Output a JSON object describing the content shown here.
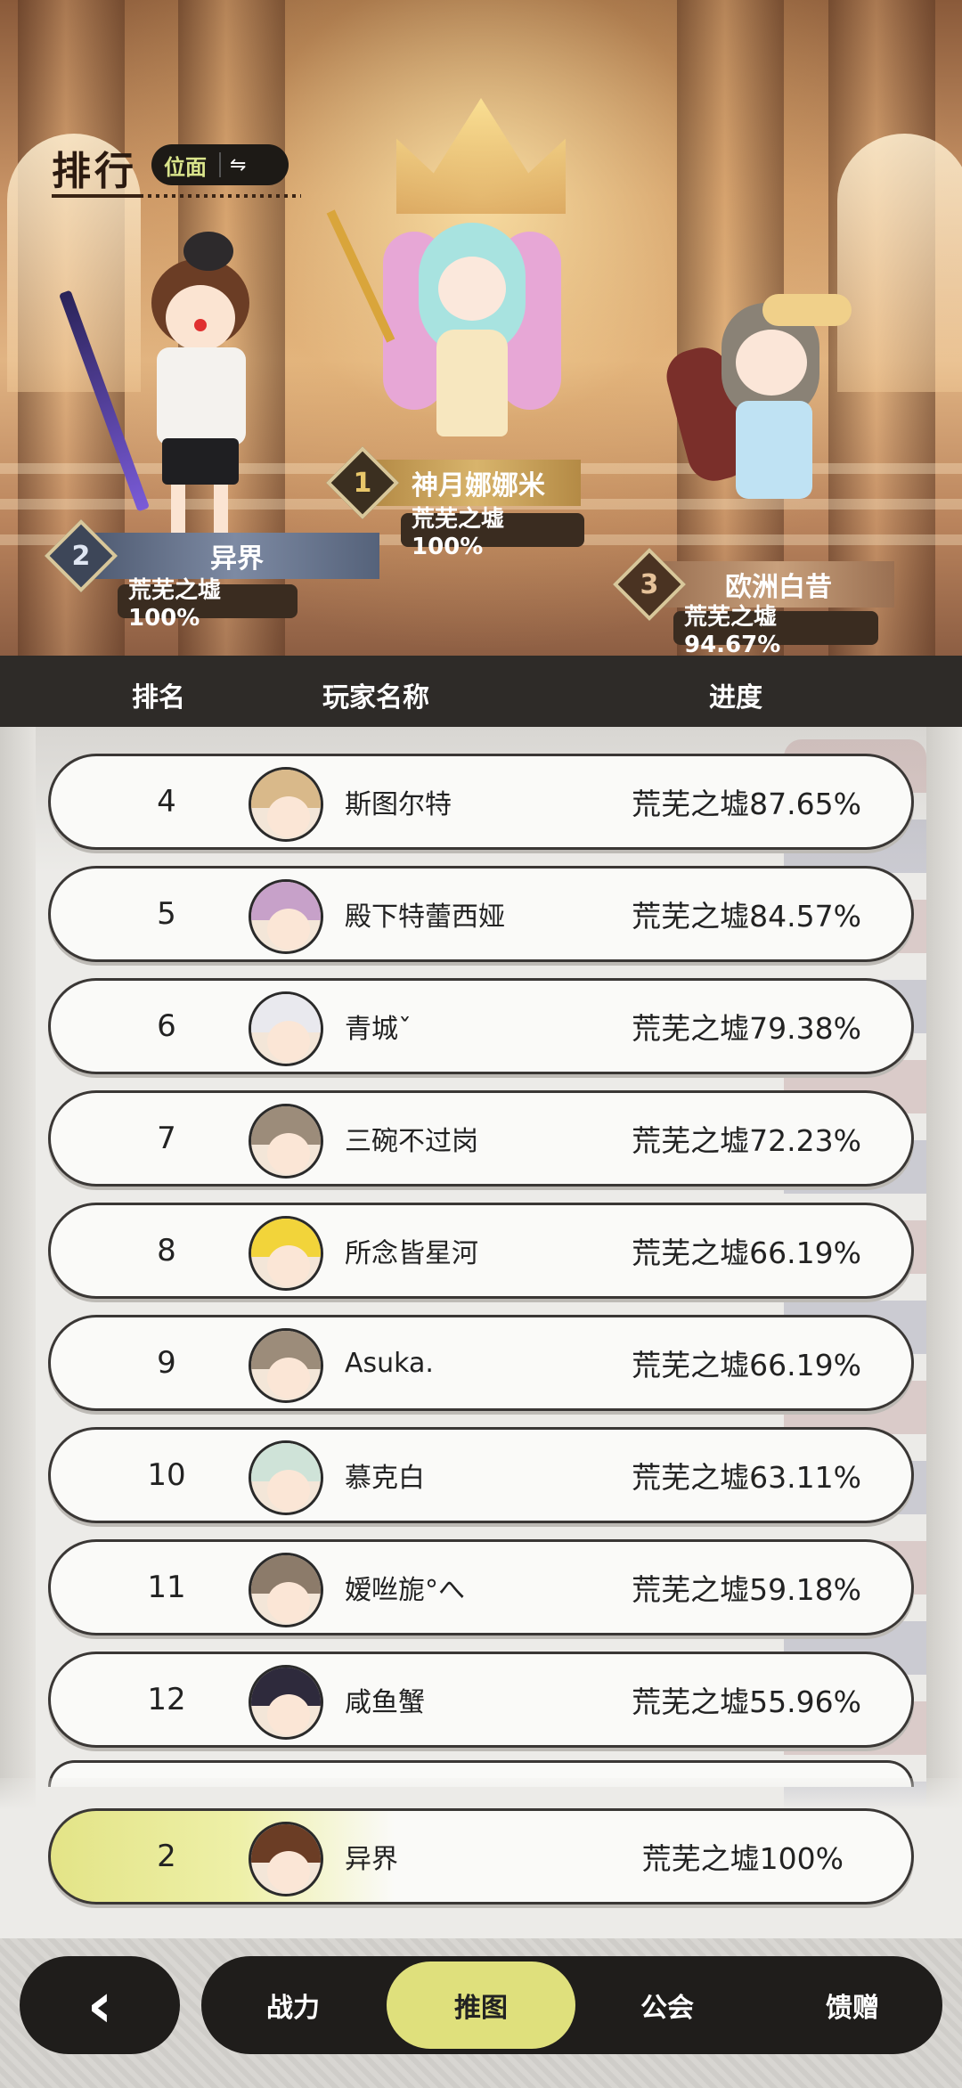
{
  "header": {
    "title": "排行",
    "scope_label": "位面",
    "swap_icon": "⇋"
  },
  "podium": [
    {
      "rank": "1",
      "name": "神月娜娜米",
      "progress": "荒芜之墟100%"
    },
    {
      "rank": "2",
      "name": "异界",
      "progress": "荒芜之墟100%"
    },
    {
      "rank": "3",
      "name": "欧洲白昔",
      "progress": "荒芜之墟94.67%"
    }
  ],
  "table": {
    "col_rank": "排名",
    "col_name": "玩家名称",
    "col_progress": "进度"
  },
  "rows": [
    {
      "rank": "4",
      "name": "斯图尔特",
      "progress": "荒芜之墟87.65%"
    },
    {
      "rank": "5",
      "name": "殿下特蕾西娅",
      "progress": "荒芜之墟84.57%"
    },
    {
      "rank": "6",
      "name": "青城ˇ",
      "progress": "荒芜之墟79.38%"
    },
    {
      "rank": "7",
      "name": "三碗不过岗",
      "progress": "荒芜之墟72.23%"
    },
    {
      "rank": "8",
      "name": "所念皆星河",
      "progress": "荒芜之墟66.19%"
    },
    {
      "rank": "9",
      "name": "Asuka.",
      "progress": "荒芜之墟66.19%"
    },
    {
      "rank": "10",
      "name": "慕克白",
      "progress": "荒芜之墟63.11%"
    },
    {
      "rank": "11",
      "name": "嫒咝旎°へ",
      "progress": "荒芜之墟59.18%"
    },
    {
      "rank": "12",
      "name": "咸鱼蟹",
      "progress": "荒芜之墟55.96%"
    }
  ],
  "self_row": {
    "rank": "2",
    "name": "异界",
    "progress": "荒芜之墟100%"
  },
  "nav": {
    "back_icon": "‹",
    "tabs": [
      {
        "label": "战力"
      },
      {
        "label": "推图"
      },
      {
        "label": "公会"
      },
      {
        "label": "馈赠"
      }
    ],
    "active_tab": "推图"
  },
  "colors": {
    "accent": "#dfe07c",
    "dark": "#1f1d1b",
    "header_bg": "#2e2b28",
    "gold_plate": "#c9a35c",
    "silver_plate": "#6e7c93",
    "bronze_plate": "#b58a62"
  }
}
